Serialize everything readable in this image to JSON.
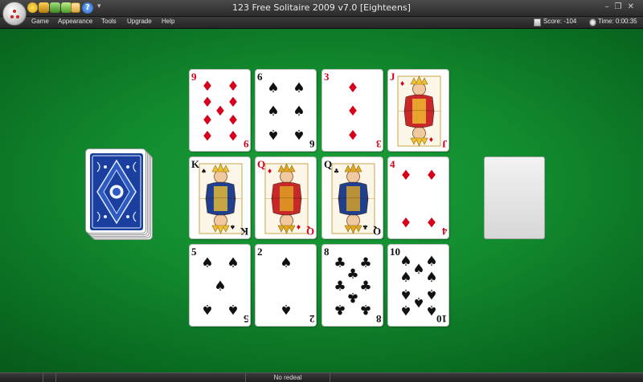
{
  "window": {
    "title": "123 Free Solitaire 2009 v7.0  [Eighteens]"
  },
  "menu": [
    "Game",
    "Appearance",
    "Tools",
    "Upgrade",
    "Help"
  ],
  "status": {
    "score": "Score:  -104",
    "time": "Time:  0:00:35"
  },
  "footer": {
    "text": "No redeal"
  },
  "icons": {
    "quick_access": [
      "new-game-icon",
      "undo-icon",
      "redo-icon",
      "hint-icon",
      "options-icon",
      "help-icon"
    ],
    "help_glyph": "?"
  },
  "colors": {
    "felt": "#128a2e",
    "card_red": "#d6001c",
    "card_back": "#1a3f9e"
  },
  "tableau": [
    [
      {
        "rank": "9",
        "suit": "♦",
        "color": "red",
        "name": "9 of diamonds"
      },
      {
        "rank": "6",
        "suit": "♠",
        "color": "black",
        "name": "6 of spades"
      },
      {
        "rank": "3",
        "suit": "♦",
        "color": "red",
        "name": "3 of diamonds"
      },
      {
        "rank": "J",
        "suit": "♦",
        "color": "red",
        "name": "jack of diamonds"
      }
    ],
    [
      {
        "rank": "K",
        "suit": "♠",
        "color": "black",
        "name": "king of spades"
      },
      {
        "rank": "Q",
        "suit": "♦",
        "color": "red",
        "name": "queen of diamonds"
      },
      {
        "rank": "Q",
        "suit": "♣",
        "color": "black",
        "name": "queen of clubs"
      },
      {
        "rank": "4",
        "suit": "♦",
        "color": "red",
        "name": "4 of diamonds"
      }
    ],
    [
      {
        "rank": "5",
        "suit": "♠",
        "color": "black",
        "name": "5 of spades"
      },
      {
        "rank": "2",
        "suit": "♠",
        "color": "black",
        "name": "2 of spades"
      },
      {
        "rank": "8",
        "suit": "♣",
        "color": "black",
        "name": "8 of clubs"
      },
      {
        "rank": "10",
        "suit": "♠",
        "color": "black",
        "name": "10 of spades"
      }
    ]
  ]
}
